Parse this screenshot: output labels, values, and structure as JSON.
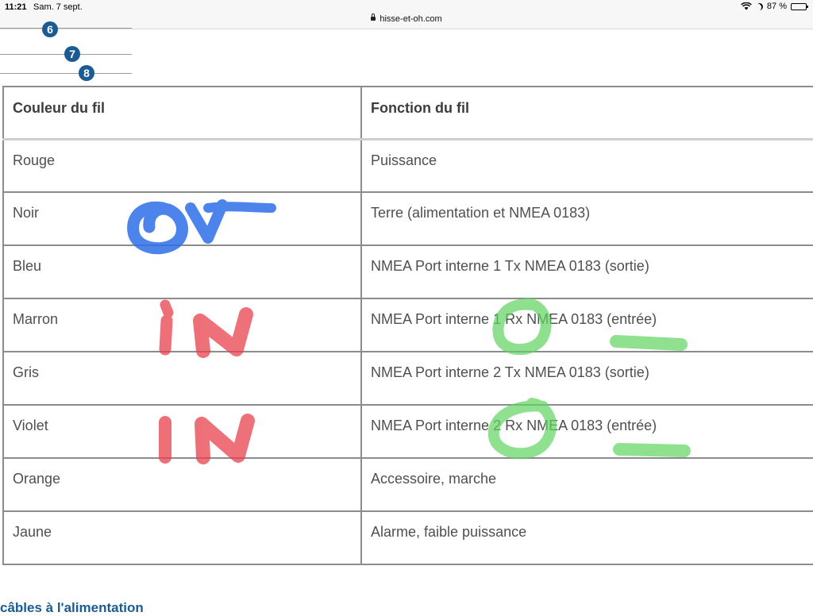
{
  "status_bar": {
    "time": "11:21",
    "date": "Sam. 7 sept.",
    "url": "hisse-et-oh.com",
    "battery": "87 %",
    "battery_level": 0.87
  },
  "steps": [
    "6",
    "7",
    "8"
  ],
  "table": {
    "headers": [
      "Couleur du fil",
      "Fonction du fil"
    ],
    "rows": [
      [
        "Rouge",
        "Puissance"
      ],
      [
        "Noir",
        "Terre (alimentation et NMEA 0183)"
      ],
      [
        "Bleu",
        "NMEA Port interne 1 Tx NMEA 0183 (sortie)"
      ],
      [
        "Marron",
        "NMEA Port interne 1 Rx NMEA 0183 (entrée)"
      ],
      [
        "Gris",
        "NMEA Port interne 2 Tx NMEA 0183 (sortie)"
      ],
      [
        "Violet",
        "NMEA Port interne 2 Rx NMEA 0183 (entrée)"
      ],
      [
        "Orange",
        "Accessoire, marche"
      ],
      [
        "Jaune",
        "Alarme, faible puissance"
      ]
    ]
  },
  "bottom_link": "câbles à l'alimentation",
  "annotations": {
    "noir": "0V",
    "marron": "IN",
    "violet": "IN",
    "blue_color": "#2f6fe8",
    "red_color": "#e8404c",
    "green_color": "#5fd45f"
  },
  "colors": {
    "accent": "#1a5b94"
  }
}
